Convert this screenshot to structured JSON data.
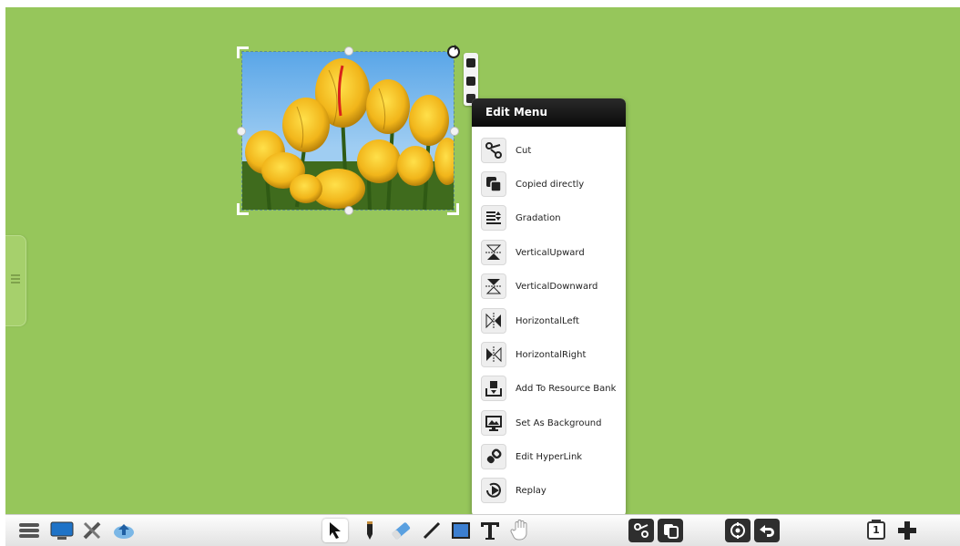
{
  "edit_menu": {
    "title": "Edit Menu",
    "items": [
      {
        "label": "Cut",
        "icon": "scissors-icon"
      },
      {
        "label": "Copied directly",
        "icon": "copy-icon"
      },
      {
        "label": "Gradation",
        "icon": "layer-order-icon"
      },
      {
        "label": "VerticalUpward",
        "icon": "flip-vertical-up-icon"
      },
      {
        "label": "VerticalDownward",
        "icon": "flip-vertical-down-icon"
      },
      {
        "label": "HorizontalLeft",
        "icon": "flip-horizontal-left-icon"
      },
      {
        "label": "HorizontalRight",
        "icon": "flip-horizontal-right-icon"
      },
      {
        "label": "Add To Resource Bank",
        "icon": "resource-bank-icon"
      },
      {
        "label": "Set As Background",
        "icon": "set-background-icon"
      },
      {
        "label": "Edit HyperLink",
        "icon": "hyperlink-icon"
      },
      {
        "label": "Replay",
        "icon": "replay-icon"
      }
    ]
  },
  "toolbar": {
    "page_number": "1"
  },
  "colors": {
    "canvas": "#96c65b",
    "menu_header": "#111111",
    "toolbar": "#ececec"
  }
}
